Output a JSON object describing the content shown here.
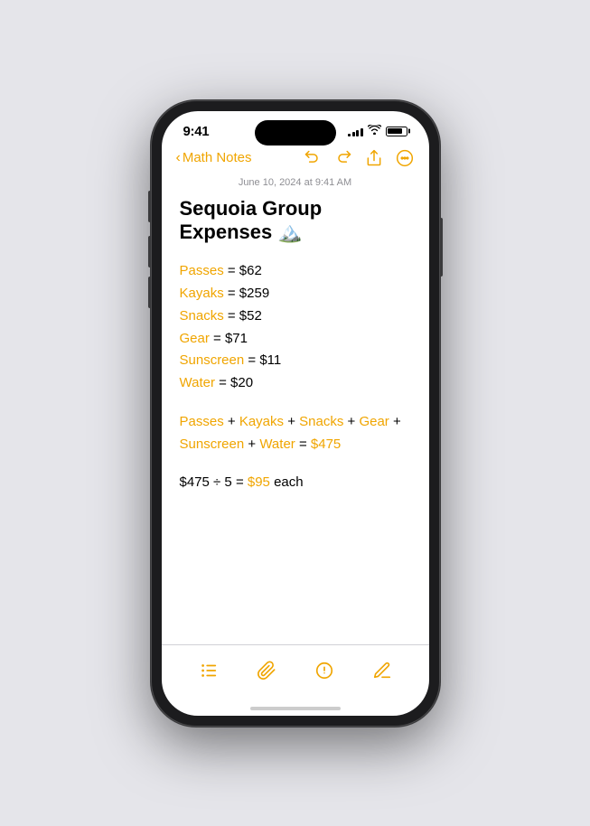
{
  "status_bar": {
    "time": "9:41",
    "signal_bars": [
      3,
      5,
      7,
      9,
      11
    ],
    "wifi": "wifi",
    "battery_percent": 85
  },
  "nav": {
    "back_label": "Math Notes",
    "back_chevron": "‹",
    "undo_icon": "undo",
    "redo_icon": "redo",
    "share_icon": "share",
    "more_icon": "more"
  },
  "note": {
    "timestamp": "June 10, 2024 at 9:41 AM",
    "title": "Sequoia Group Expenses 🏔️",
    "items": [
      {
        "label": "Passes",
        "value": "= $62"
      },
      {
        "label": "Kayaks",
        "value": "= $259"
      },
      {
        "label": "Snacks",
        "value": "= $52"
      },
      {
        "label": "Gear",
        "value": "= $71"
      },
      {
        "label": "Sunscreen",
        "value": "= $11"
      },
      {
        "label": "Water",
        "value": "= $20"
      }
    ],
    "equation_parts": [
      "Passes",
      "+",
      "Kayaks",
      "+",
      "Snacks",
      "+",
      "Gear",
      "+",
      "Sunscreen",
      "+",
      "Water",
      "=",
      "$475"
    ],
    "equation_line1": "Passes + Kayaks + Snacks + Gear +",
    "equation_line2": "Sunscreen + Water =",
    "equation_result": "$475",
    "calc_text": "$475 ÷ 5 =",
    "calc_result": "$95",
    "calc_suffix": "each"
  },
  "toolbar": {
    "checklist_label": "checklist",
    "attachment_label": "attachment",
    "markup_label": "markup",
    "compose_label": "compose"
  },
  "colors": {
    "accent": "#f0a500",
    "text": "#000000",
    "secondary": "#8e8e93"
  }
}
